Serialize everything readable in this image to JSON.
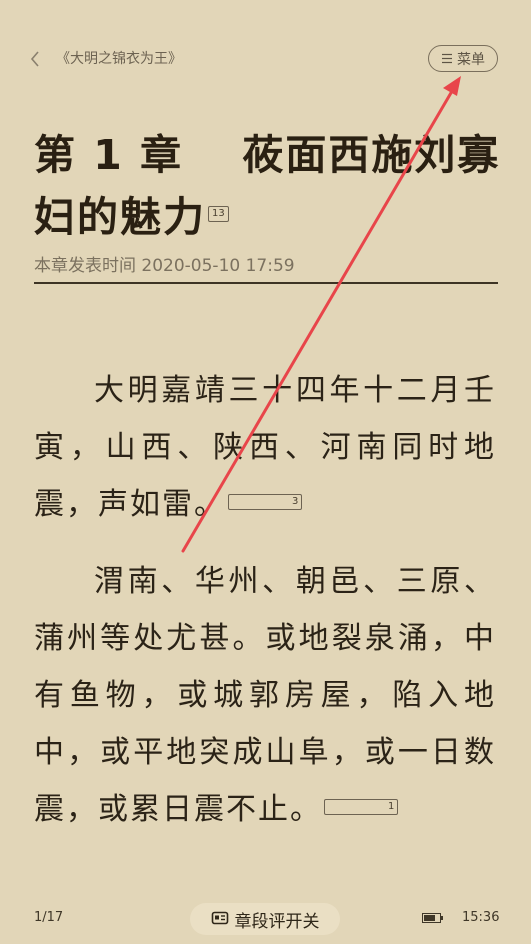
{
  "header": {
    "back_icon": "chevron-left-icon",
    "book_title": "《大明之锦衣为王》",
    "menu_icon": "menu-lines-icon",
    "menu_label": "菜单"
  },
  "chapter": {
    "title": "第 1 章　 莜面西施刘寡妇的魅力",
    "title_comment_count": "13",
    "publish_time": "本章发表时间 2020-05-10 17:59"
  },
  "paragraphs": [
    {
      "text": "大明嘉靖三十四年十二月壬寅，山西、陕西、河南同时地震，声如雷。",
      "comment_count": "3"
    },
    {
      "text": "渭南、华州、朝邑、三原、蒲州等处尤甚。或地裂泉涌，中有鱼物，或城郭房屋，陷入地中，或平地突成山阜，或一日数震，或累日震不止。",
      "comment_count": "1"
    }
  ],
  "footer": {
    "page": "1/17",
    "review_icon": "comment-icon",
    "review_toggle_label": "章段评开关",
    "battery_icon": "battery-icon",
    "time": "15:36"
  },
  "colors": {
    "background": "#e2d6b8",
    "annotation_arrow": "#e8454a"
  }
}
